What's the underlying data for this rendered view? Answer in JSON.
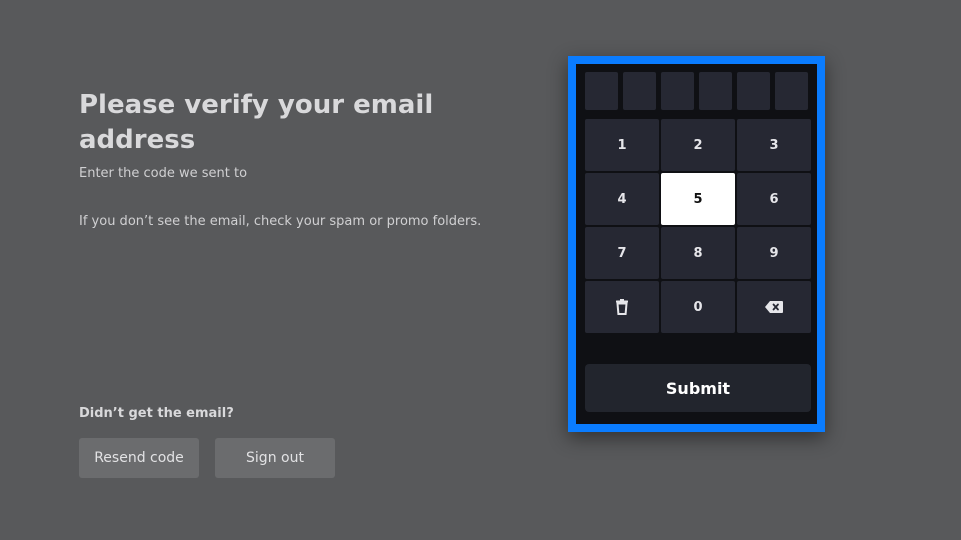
{
  "left": {
    "title": "Please verify your email address",
    "subtitle": "Enter the code we sent to",
    "hint": "If you don’t see the email, check your spam or promo folders.",
    "didnt_get": "Didn’t get the email?",
    "resend_label": "Resend code",
    "signout_label": "Sign out"
  },
  "keypad": {
    "code_cells": 6,
    "keys": [
      "1",
      "2",
      "3",
      "4",
      "5",
      "6",
      "7",
      "8",
      "9",
      "",
      "0",
      ""
    ],
    "key_icons": [
      "",
      "",
      "",
      "",
      "",
      "",
      "",
      "",
      "",
      "trash-icon",
      "",
      "backspace-icon"
    ],
    "focused_key": "5",
    "submit_label": "Submit"
  },
  "colors": {
    "background": "#58595b",
    "focus_border": "#0a7cff",
    "key_bg": "#262833",
    "key_active_bg": "#ffffff"
  }
}
